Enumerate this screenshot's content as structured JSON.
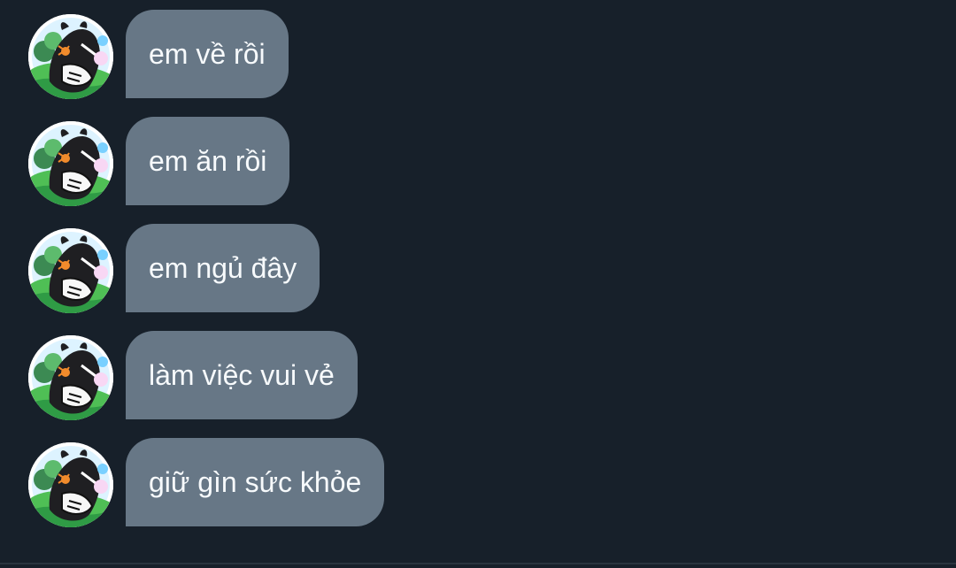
{
  "chat": {
    "messages": [
      {
        "text": "em về rồi",
        "avatar_icon": "avatar-icon"
      },
      {
        "text": "em ăn rồi",
        "avatar_icon": "avatar-icon"
      },
      {
        "text": "em ngủ đây",
        "avatar_icon": "avatar-icon"
      },
      {
        "text": "làm việc vui vẻ",
        "avatar_icon": "avatar-icon"
      },
      {
        "text": "giữ gìn sức khỏe",
        "avatar_icon": "avatar-icon"
      }
    ]
  },
  "colors": {
    "background": "#17202a",
    "bubble": "#677786",
    "bubble_text": "#f7fafc",
    "avatar_ring": "#ffffff"
  }
}
